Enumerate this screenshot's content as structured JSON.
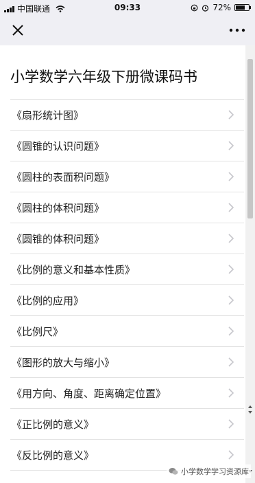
{
  "status_bar": {
    "carrier": "中国联通",
    "time": "09:33",
    "battery_text": "72%",
    "battery_level": 0.72
  },
  "nav": {
    "close_icon": "close-icon",
    "more_icon": "more-dots-icon"
  },
  "page": {
    "title": "小学数学六年级下册微课码书"
  },
  "list": {
    "items": [
      {
        "label": "《扇形统计图》"
      },
      {
        "label": "《圆锥的认识问题》"
      },
      {
        "label": "《圆柱的表面积问题》"
      },
      {
        "label": "《圆柱的体积问题》"
      },
      {
        "label": "《圆锥的体积问题》"
      },
      {
        "label": "《比例的意义和基本性质》"
      },
      {
        "label": "《比例的应用》"
      },
      {
        "label": "《比例尺》"
      },
      {
        "label": "《图形的放大与缩小》"
      },
      {
        "label": "《用方向、角度、距离确定位置》"
      },
      {
        "label": "《正比例的意义》"
      },
      {
        "label": "《反比例的意义》"
      }
    ]
  },
  "watermark": {
    "text": "小学数学学习资源库"
  },
  "colors": {
    "bar_bg": "#efeff4",
    "divider": "#e2e2e2",
    "chevron": "#c7c7cc"
  }
}
